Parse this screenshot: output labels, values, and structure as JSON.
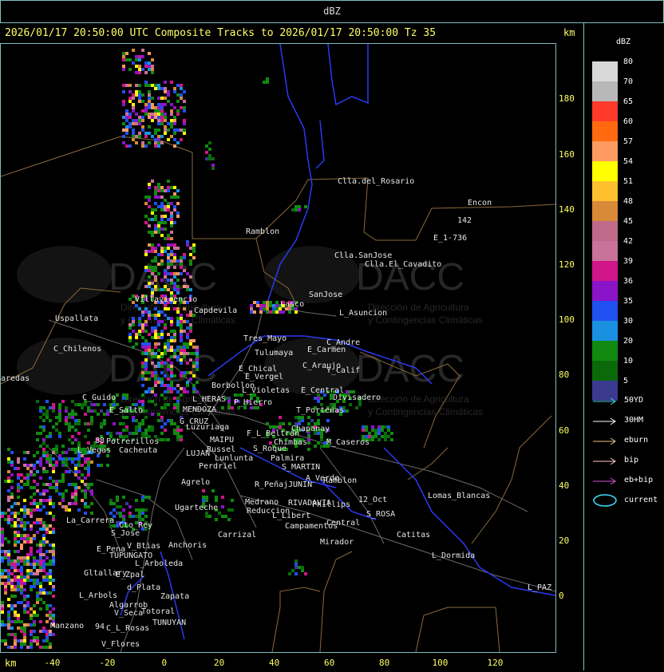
{
  "window": {
    "title": "dBZ"
  },
  "header": {
    "caption": "2026/01/17 20:50:00 UTC Composite Tracks to 2026/01/17 20:50:00 Tz 35",
    "km_right": "km",
    "km_bottom": "km"
  },
  "axes": {
    "y_ticks": [
      "180",
      "160",
      "140",
      "120",
      "100",
      "80",
      "60",
      "40",
      "20",
      "0"
    ],
    "x_ticks": [
      "-40",
      "-20",
      "0",
      "20",
      "40",
      "60",
      "80",
      "100",
      "120"
    ]
  },
  "legend": {
    "title": "dBZ",
    "scale": [
      {
        "label": "80",
        "color": "#d8d8d8"
      },
      {
        "label": "70",
        "color": "#b8b8b8"
      },
      {
        "label": "65",
        "color": "#ff3a2a"
      },
      {
        "label": "60",
        "color": "#ff6a10"
      },
      {
        "label": "57",
        "color": "#ff9a60"
      },
      {
        "label": "54",
        "color": "#ffff00"
      },
      {
        "label": "51",
        "color": "#ffc030"
      },
      {
        "label": "48",
        "color": "#d88a38"
      },
      {
        "label": "45",
        "color": "#c06a8a"
      },
      {
        "label": "42",
        "color": "#c9729a"
      },
      {
        "label": "39",
        "color": "#d0148a"
      },
      {
        "label": "36",
        "color": "#8a14c8"
      },
      {
        "label": "35",
        "color": "#2050f0"
      },
      {
        "label": "30",
        "color": "#1a90e0"
      },
      {
        "label": "20",
        "color": "#108a10"
      },
      {
        "label": "10",
        "color": "#0a6a0a"
      },
      {
        "label": "5",
        "color": "#3a3a90"
      }
    ],
    "tracks": [
      {
        "label": "50YD",
        "color": "#40d0d0"
      },
      {
        "label": "30HM",
        "color": "#ffffff"
      },
      {
        "label": "eburn",
        "color": "#e8c080"
      },
      {
        "label": "bip",
        "color": "#ffc8c8"
      },
      {
        "label": "eb+bip",
        "color": "#d050d0"
      },
      {
        "label": "current",
        "color": "#40e0ff"
      }
    ]
  },
  "watermark": {
    "brand": "DACC",
    "line1": "Dirección de Agricultura",
    "line2": "y Contingencias Climáticas"
  },
  "places": [
    {
      "name": "Clla.del_Rosario"
    },
    {
      "name": "Encon"
    },
    {
      "name": "E_1-736"
    },
    {
      "name": "142"
    },
    {
      "name": "Ramblon"
    },
    {
      "name": "Clla.SanJose"
    },
    {
      "name": "Clla.El_Cavadito"
    },
    {
      "name": "Villavicencio"
    },
    {
      "name": "Capdevila"
    },
    {
      "name": "Lasco"
    },
    {
      "name": "SanJose"
    },
    {
      "name": "L_Asuncion"
    },
    {
      "name": "Uspallata"
    },
    {
      "name": "Tres_Mayo"
    },
    {
      "name": "C_Andre"
    },
    {
      "name": "Tulumaya"
    },
    {
      "name": "E_Carmen"
    },
    {
      "name": "C_Chilenos"
    },
    {
      "name": "E_Chical"
    },
    {
      "name": "C_Araujo"
    },
    {
      "name": "E_Vergel"
    },
    {
      "name": "Y_Calif"
    },
    {
      "name": "aredas"
    },
    {
      "name": "Borbollon"
    },
    {
      "name": "L_Violetas"
    },
    {
      "name": "E_Central"
    },
    {
      "name": "Divisadero"
    },
    {
      "name": "C_Guido"
    },
    {
      "name": "L_HERAS"
    },
    {
      "name": "P_Hierro"
    },
    {
      "name": "E_Salto"
    },
    {
      "name": "MENDOZA"
    },
    {
      "name": "T_Porteñas"
    },
    {
      "name": "G_CRUZ"
    },
    {
      "name": "Chapanay"
    },
    {
      "name": "Luzuriaga"
    },
    {
      "name": "F_L_Beltran"
    },
    {
      "name": "88"
    },
    {
      "name": "Potrerillos"
    },
    {
      "name": "MAIPU"
    },
    {
      "name": "Chimbas"
    },
    {
      "name": "M_Caseros"
    },
    {
      "name": "L_Vegas"
    },
    {
      "name": "Cacheuta"
    },
    {
      "name": "Russel"
    },
    {
      "name": "S_Roque"
    },
    {
      "name": "LUJAN"
    },
    {
      "name": "Lunlunta"
    },
    {
      "name": "Palmira"
    },
    {
      "name": "Perdriel"
    },
    {
      "name": "S_MARTIN"
    },
    {
      "name": "Agrelo"
    },
    {
      "name": "A_Verde"
    },
    {
      "name": "Ramblon"
    },
    {
      "name": "R_Peñaj"
    },
    {
      "name": "JUNIN"
    },
    {
      "name": "Lomas_Blancas"
    },
    {
      "name": "Medrano"
    },
    {
      "name": "RIVADAVIA"
    },
    {
      "name": "Phillips"
    },
    {
      "name": "12_Oct"
    },
    {
      "name": "Ugarteche"
    },
    {
      "name": "Reduccion"
    },
    {
      "name": "S_ROSA"
    },
    {
      "name": "L_Libert"
    },
    {
      "name": "La_Carrera"
    },
    {
      "name": "Cto_Rey"
    },
    {
      "name": "Campamentos"
    },
    {
      "name": "Central"
    },
    {
      "name": "S_Jose"
    },
    {
      "name": "Carrizal"
    },
    {
      "name": "Catitas"
    },
    {
      "name": "Anchoris"
    },
    {
      "name": "Mirador"
    },
    {
      "name": "E_Pena"
    },
    {
      "name": "V_Btias"
    },
    {
      "name": "TUPUNGATO"
    },
    {
      "name": "L_Dormida"
    },
    {
      "name": "L_Arboleda"
    },
    {
      "name": "Gltallary"
    },
    {
      "name": "E_Zpal"
    },
    {
      "name": "d_Plata"
    },
    {
      "name": "L_Arbols"
    },
    {
      "name": "Zapata"
    },
    {
      "name": "Algarrob"
    },
    {
      "name": "L_PAZ"
    },
    {
      "name": "V_Seca"
    },
    {
      "name": "Totoral"
    },
    {
      "name": "TUNUYAN"
    },
    {
      "name": "Manzano"
    },
    {
      "name": "94"
    },
    {
      "name": "C_L_Rosas"
    },
    {
      "name": "V_Flores"
    }
  ],
  "colors": {
    "frame": "#7fbfbf",
    "boundary": "#8a6a3a",
    "road": "#6a6a6a",
    "river": "#2a3af0",
    "axis_text": "#ffff66"
  }
}
